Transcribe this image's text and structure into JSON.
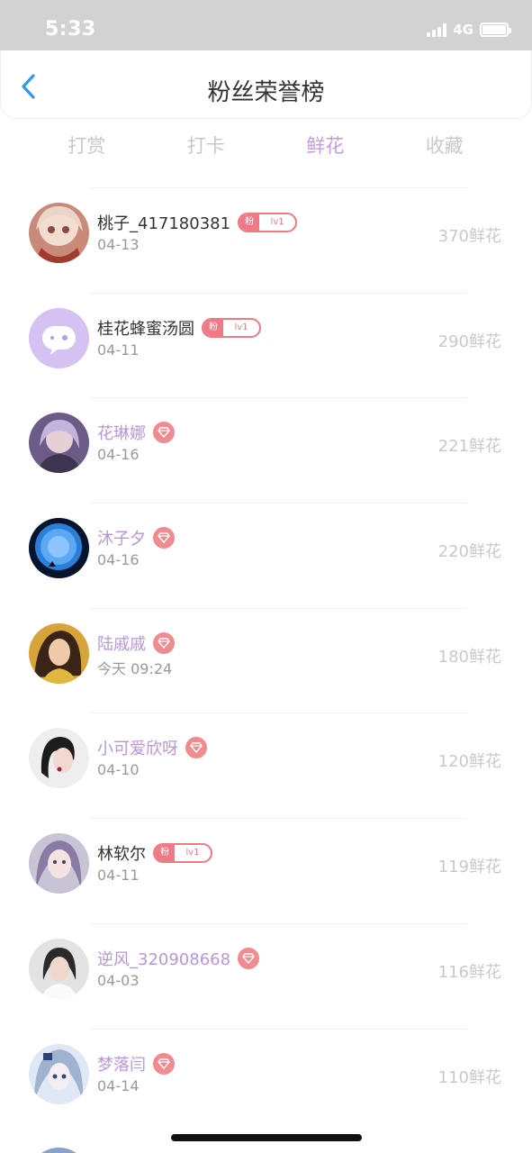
{
  "status": {
    "time": "5:33",
    "network": "4G"
  },
  "nav": {
    "title": "粉丝荣誉榜"
  },
  "tabs": [
    {
      "label": "打赏",
      "active": false
    },
    {
      "label": "打卡",
      "active": false
    },
    {
      "label": "鲜花",
      "active": true
    },
    {
      "label": "收藏",
      "active": false
    }
  ],
  "fans": [
    {
      "name": "桃子_417180381",
      "date": "04-13",
      "count": "370鲜花",
      "badge": "fan",
      "badge_prefix": "粉",
      "badge_level": "lv1",
      "avatar": "anime-girl"
    },
    {
      "name": "桂花蜂蜜汤圆",
      "date": "04-11",
      "count": "290鲜花",
      "badge": "fan",
      "badge_prefix": "粉",
      "badge_level": "lv1",
      "avatar": "default-chat"
    },
    {
      "name": "花琳娜",
      "date": "04-16",
      "count": "221鲜花",
      "badge": "diamond",
      "avatar": "photo-purple"
    },
    {
      "name": "沐子夕",
      "date": "04-16",
      "count": "220鲜花",
      "badge": "diamond",
      "avatar": "moon"
    },
    {
      "name": "陆戚戚",
      "date": "今天 09:24",
      "count": "180鲜花",
      "badge": "diamond",
      "avatar": "photo-warm"
    },
    {
      "name": "小可爱欣呀",
      "date": "04-10",
      "count": "120鲜花",
      "badge": "diamond",
      "avatar": "photo-light"
    },
    {
      "name": "林软尔",
      "date": "04-11",
      "count": "119鲜花",
      "badge": "fan",
      "badge_prefix": "粉",
      "badge_level": "lv1",
      "avatar": "photo-lilac"
    },
    {
      "name": "逆风_320908668",
      "date": "04-03",
      "count": "116鲜花",
      "badge": "diamond",
      "avatar": "photo-gray"
    },
    {
      "name": "梦落闫",
      "date": "04-14",
      "count": "110鲜花",
      "badge": "diamond",
      "avatar": "anime-blue"
    }
  ],
  "colors": {
    "accent": "#c79bde",
    "vip_name": "#b996d9",
    "fan_badge": "#ef7a86",
    "diamond_badge": "#f08b90"
  }
}
